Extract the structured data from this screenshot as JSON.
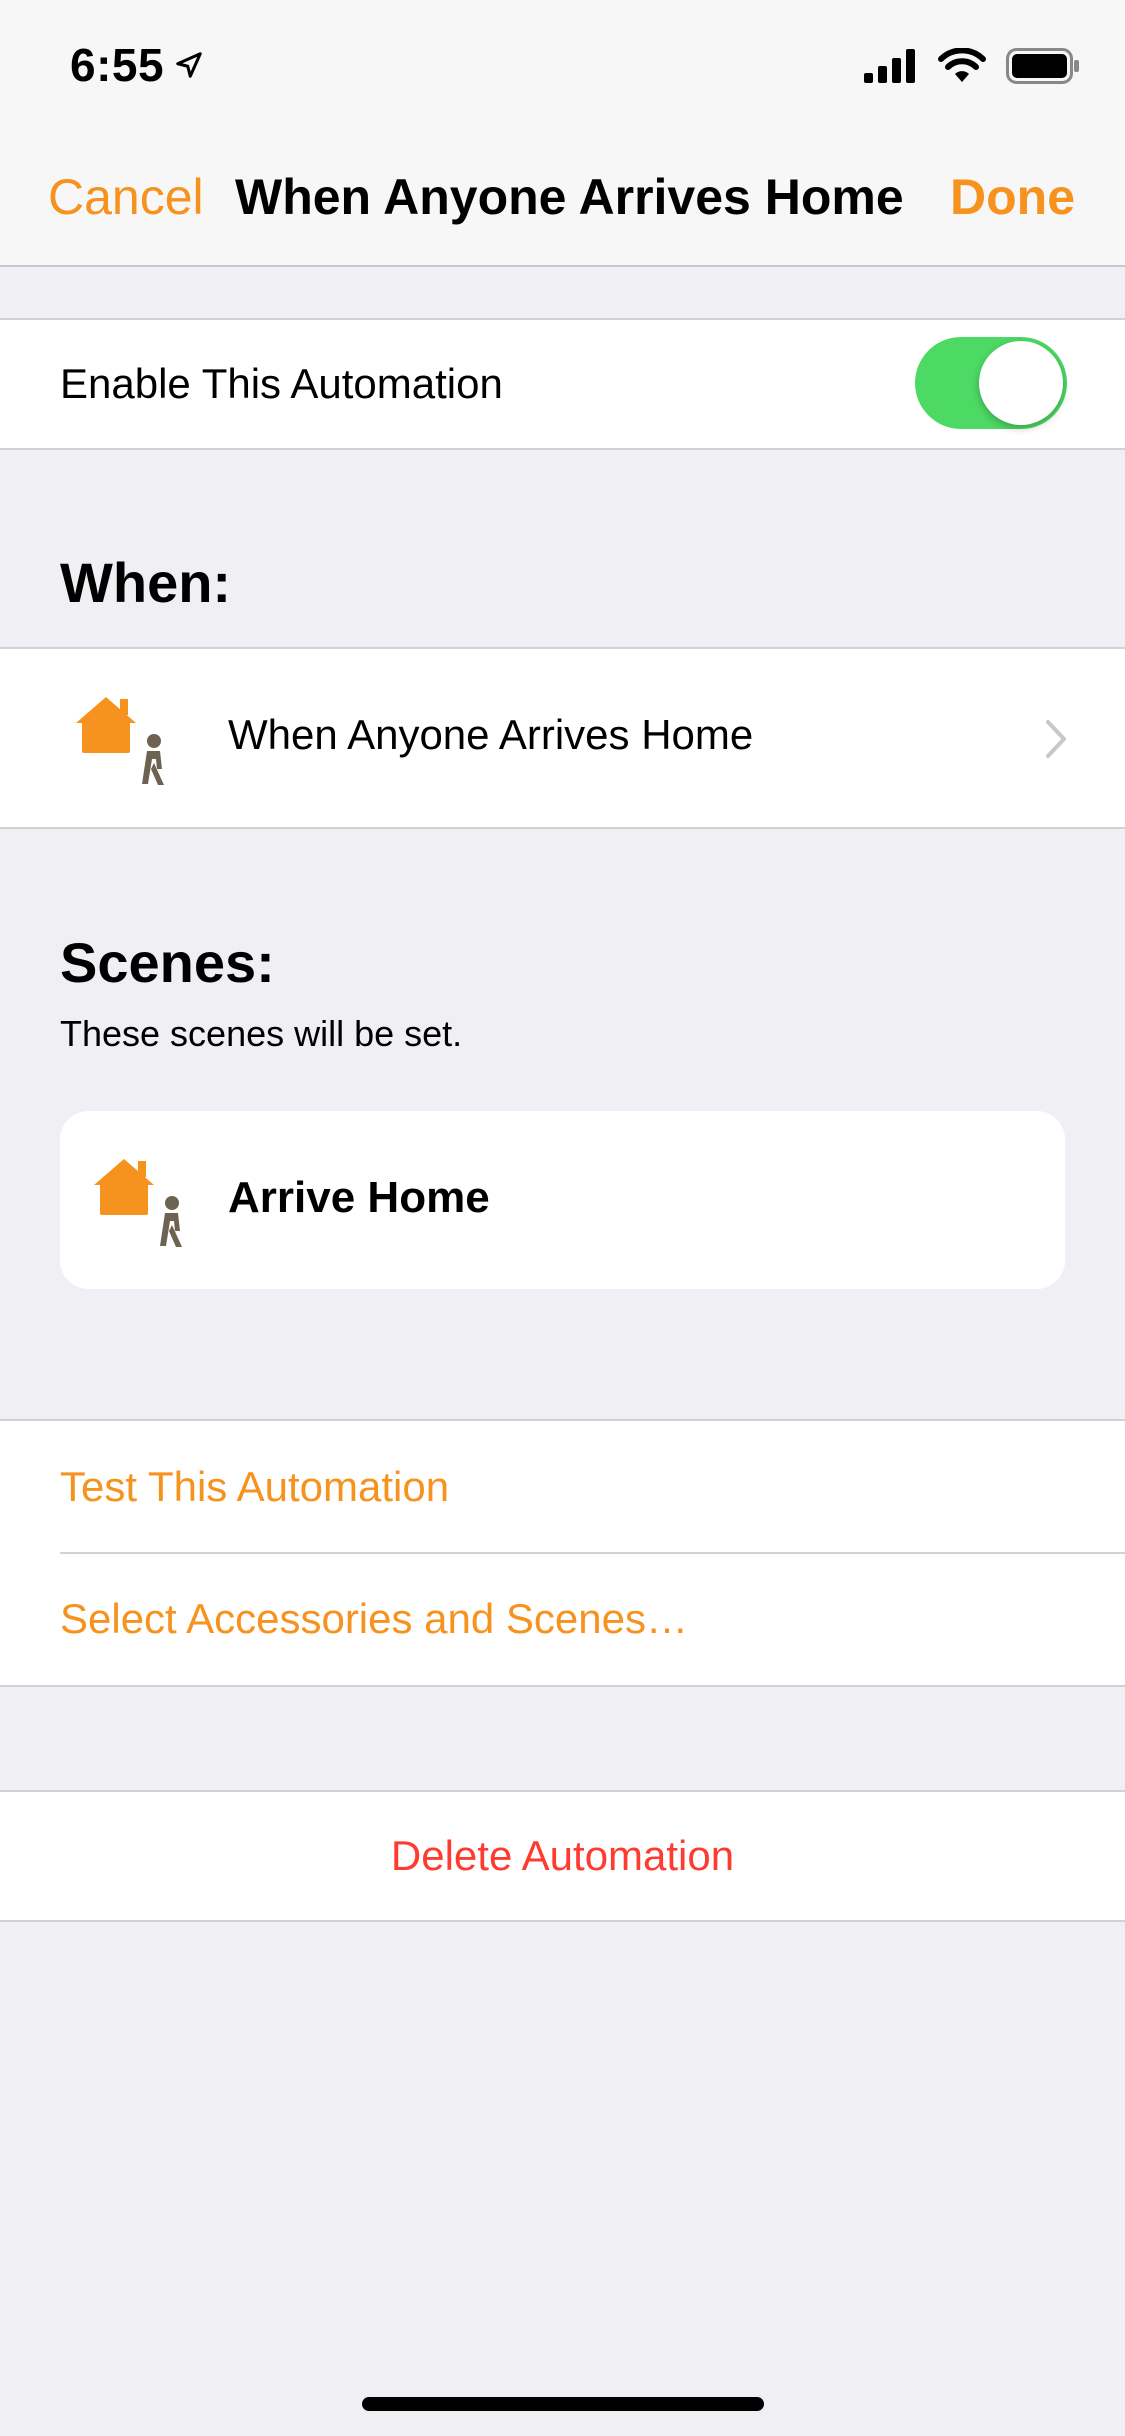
{
  "status_bar": {
    "time": "6:55",
    "icons": [
      "location-arrow-icon",
      "cellular-signal-icon",
      "wifi-icon",
      "battery-icon"
    ]
  },
  "nav": {
    "cancel_label": "Cancel",
    "title": "When Anyone Arrives Home",
    "done_label": "Done"
  },
  "enable": {
    "label": "Enable This Automation",
    "toggle_on": true
  },
  "when": {
    "header": "When:",
    "trigger_label": "When Anyone Arrives Home",
    "trigger_icon": "house-person-arriving-icon"
  },
  "scenes": {
    "header": "Scenes:",
    "subtitle": "These scenes will be set.",
    "items": [
      {
        "label": "Arrive Home",
        "icon": "house-person-arriving-icon"
      }
    ]
  },
  "actions": {
    "test_label": "Test This Automation",
    "select_label": "Select Accessories and Scenes…"
  },
  "delete": {
    "label": "Delete Automation"
  },
  "colors": {
    "accent": "#F6921E",
    "destructive": "#FF3B30",
    "toggle_on": "#4CD964",
    "background": "#EFEFF4",
    "house_orange": "#F6921E",
    "person_gray": "#6E6253"
  }
}
